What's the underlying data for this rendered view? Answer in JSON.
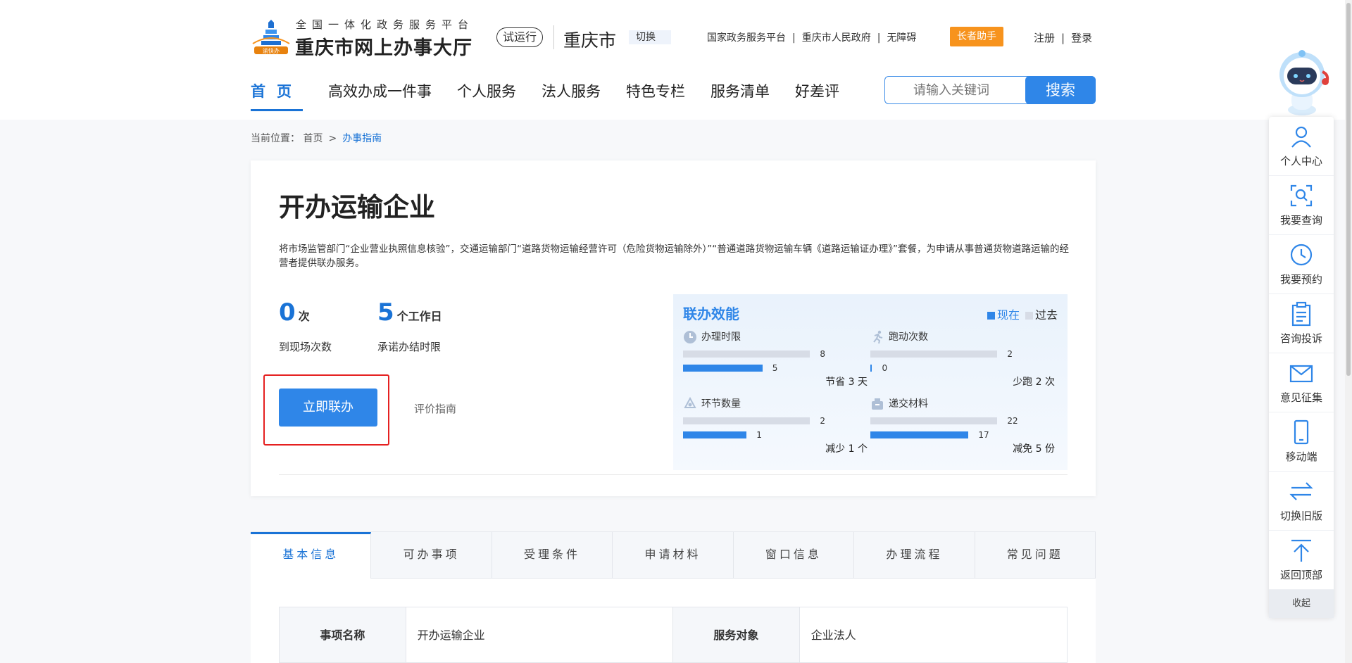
{
  "header": {
    "subtitle": "全国一体化政务服务平台",
    "title": "重庆市网上办事大厅",
    "trial_badge": "试运行",
    "city": "重庆市",
    "switch_city": "切换",
    "links": [
      "国家政务服务平台",
      "重庆市人民政府",
      "无障碍"
    ],
    "elder_helper": "长者助手",
    "register": "注册",
    "login": "登录",
    "separator": "|",
    "logo_text": "渝快办"
  },
  "nav": {
    "items": [
      "首页",
      "高效办成一件事",
      "个人服务",
      "法人服务",
      "特色专栏",
      "服务清单",
      "好差评"
    ],
    "active_index": 0
  },
  "search": {
    "placeholder": "请输入关键词",
    "button": "搜索"
  },
  "breadcrumb": {
    "label": "当前位置：",
    "home": "首页",
    "sep": ">",
    "current": "办事指南"
  },
  "card": {
    "title": "开办运输企业",
    "description": "将市场监管部门“企业营业执照信息核验”，交通运输部门“道路货物运输经营许可（危险货物运输除外）”“普通道路货物运输车辆《道路运输证办理》”套餐，为申请从事普通货物道路运输的经营者提供联办服务。",
    "stats": [
      {
        "num": "0",
        "unit": "次",
        "label": "到现场次数"
      },
      {
        "num": "5",
        "unit": "个工作日",
        "label": "承诺办结时限"
      }
    ],
    "apply_button": "立即联办",
    "guide_link": "评价指南"
  },
  "efficiency": {
    "title": "联办效能",
    "legend_now": "现在",
    "legend_past": "过去",
    "metrics": [
      {
        "icon": "clock-icon",
        "name": "办理时限",
        "past": 8,
        "now": 5,
        "past_label": "8",
        "now_label": "5",
        "saving": "节省 3 天"
      },
      {
        "icon": "running-icon",
        "name": "跑动次数",
        "past": 2,
        "now": 0,
        "past_label": "2",
        "now_label": "0",
        "saving": "少跑 2 次"
      },
      {
        "icon": "cycle-icon",
        "name": "环节数量",
        "past": 2,
        "now": 1,
        "past_label": "2",
        "now_label": "1",
        "saving": "减少 1 个"
      },
      {
        "icon": "folder-icon",
        "name": "递交材料",
        "past": 22,
        "now": 17,
        "past_label": "22",
        "now_label": "17",
        "saving": "减免 5 份"
      }
    ]
  },
  "tabs": [
    "基本信息",
    "可办事项",
    "受理条件",
    "申请材料",
    "窗口信息",
    "办理流程",
    "常见问题"
  ],
  "info_table": {
    "name_label": "事项名称",
    "name_value": "开办运输企业",
    "target_label": "服务对象",
    "target_value": "企业法人"
  },
  "float_bar": {
    "items": [
      {
        "icon": "user-icon",
        "label": "个人中心"
      },
      {
        "icon": "search-doc-icon",
        "label": "我要查询"
      },
      {
        "icon": "clock-icon",
        "label": "我要预约"
      },
      {
        "icon": "clipboard-icon",
        "label": "咨询投诉"
      },
      {
        "icon": "mail-icon",
        "label": "意见征集"
      },
      {
        "icon": "mobile-icon",
        "label": "移动端"
      },
      {
        "icon": "switch-icon",
        "label": "切换旧版"
      },
      {
        "icon": "back-to-top-icon",
        "label": "返回顶部"
      }
    ],
    "collapse": "收起"
  },
  "colors": {
    "primary": "#2f86e8",
    "accent": "#f7931d",
    "highlight": "#e52020"
  }
}
